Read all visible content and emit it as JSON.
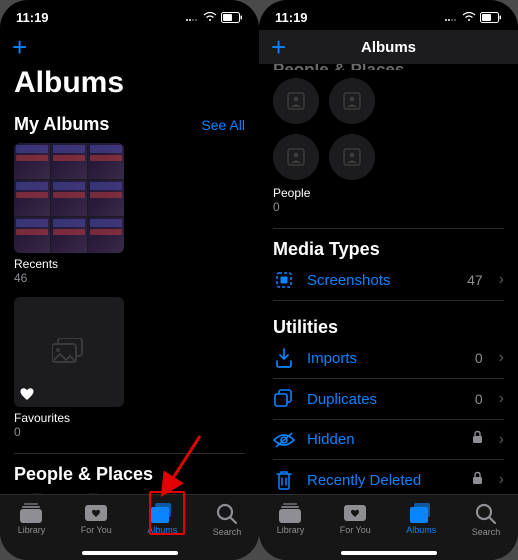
{
  "status": {
    "time": "11:19"
  },
  "left": {
    "add_label": "+",
    "large_title": "Albums",
    "my_albums": {
      "title": "My Albums",
      "see_all": "See All",
      "recents": {
        "label": "Recents",
        "count": "46"
      },
      "favourites": {
        "label": "Favourites",
        "count": "0"
      }
    },
    "people_places": {
      "title": "People & Places"
    }
  },
  "right": {
    "add_label": "+",
    "nav_title": "Albums",
    "people_places_header": "People & Places",
    "people": {
      "label": "People",
      "count": "0"
    },
    "media_types": {
      "title": "Media Types",
      "screenshots": {
        "label": "Screenshots",
        "count": "47"
      }
    },
    "utilities": {
      "title": "Utilities",
      "imports": {
        "label": "Imports",
        "count": "0"
      },
      "duplicates": {
        "label": "Duplicates",
        "count": "0"
      },
      "hidden": {
        "label": "Hidden"
      },
      "recently_deleted": {
        "label": "Recently Deleted"
      }
    }
  },
  "tabs": {
    "library": "Library",
    "for_you": "For You",
    "albums": "Albums",
    "search": "Search"
  }
}
